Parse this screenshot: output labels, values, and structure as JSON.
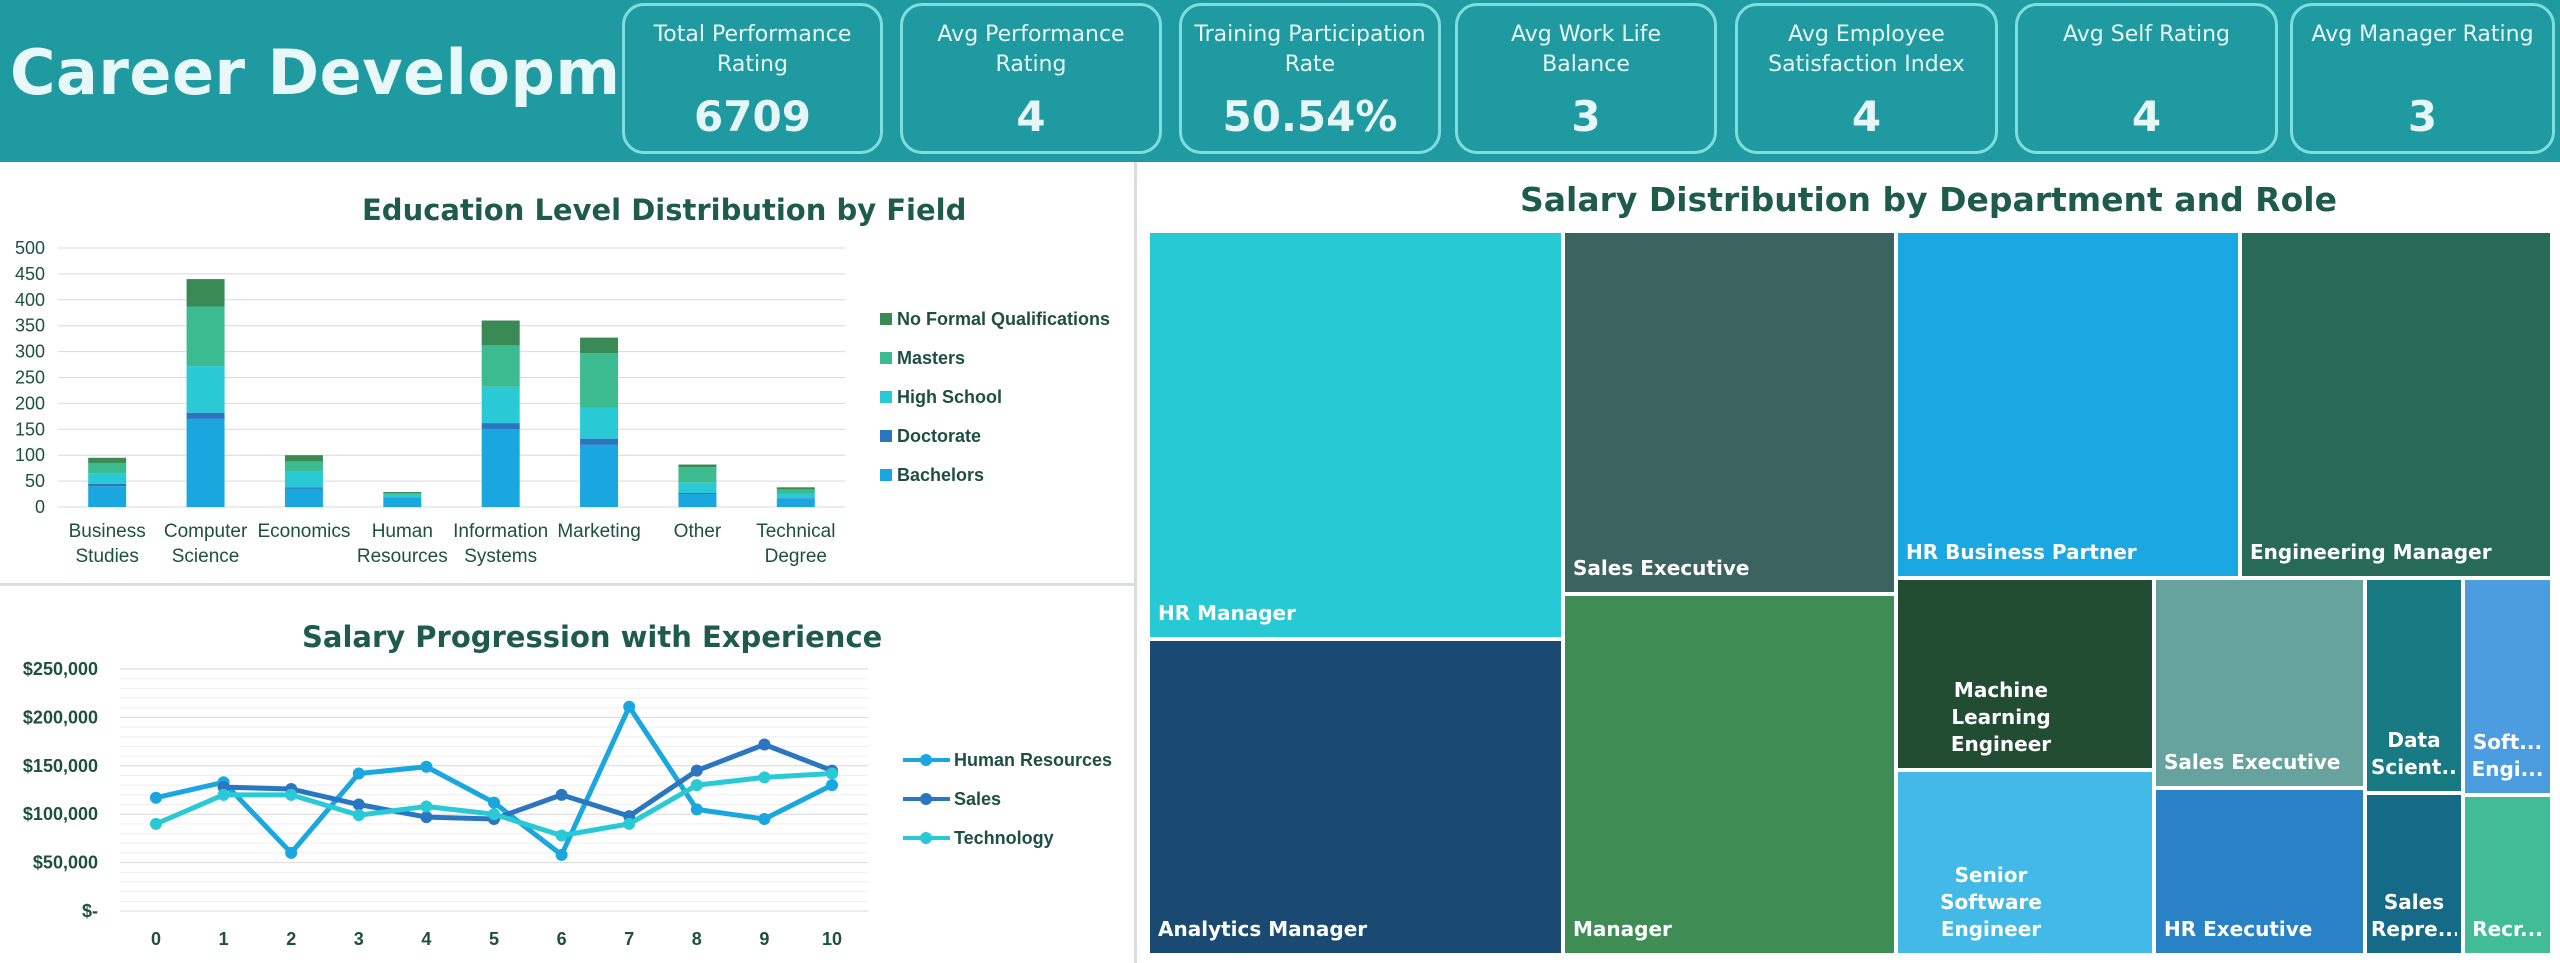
{
  "header": {
    "title": "Career Development",
    "kpis": [
      {
        "label": "Total Performance Rating",
        "value": "6709"
      },
      {
        "label": "Avg Performance Rating",
        "value": "4"
      },
      {
        "label": "Training Participation Rate",
        "value": "50.54%"
      },
      {
        "label": "Avg Work Life Balance",
        "value": "3"
      },
      {
        "label": "Avg Employee Satisfaction Index",
        "value": "4"
      },
      {
        "label": "Avg Self Rating",
        "value": "4"
      },
      {
        "label": "Avg Manager Rating",
        "value": "3"
      }
    ]
  },
  "colors": {
    "header_bg": "#1f9aa0",
    "kpi_border": "#7fdde0",
    "title_text": "#1e5b4a"
  },
  "chart_data": [
    {
      "type": "bar",
      "stacked": true,
      "title": "Education Level Distribution by Field",
      "categories": [
        "Business Studies",
        "Computer Science",
        "Economics",
        "Human Resources",
        "Information Systems",
        "Marketing",
        "Other",
        "Technical Degree"
      ],
      "category_lines": [
        [
          "Business",
          "Studies"
        ],
        [
          "Computer",
          "Science"
        ],
        [
          "Economics"
        ],
        [
          "Human",
          "Resources"
        ],
        [
          "Information",
          "Systems"
        ],
        [
          "Marketing"
        ],
        [
          "Other"
        ],
        [
          "Technical",
          "Degree"
        ]
      ],
      "ylim": [
        0,
        500
      ],
      "yticks": [
        0,
        50,
        100,
        150,
        200,
        250,
        300,
        350,
        400,
        450,
        500
      ],
      "legend_position": "right",
      "series": [
        {
          "name": "Bachelors",
          "color": "#1aa7e0",
          "values": [
            40,
            170,
            35,
            18,
            150,
            120,
            25,
            17
          ]
        },
        {
          "name": "Doctorate",
          "color": "#2b76c0",
          "values": [
            5,
            12,
            3,
            1,
            12,
            12,
            2,
            1
          ]
        },
        {
          "name": "High School",
          "color": "#2ac9d6",
          "values": [
            20,
            90,
            30,
            5,
            70,
            60,
            20,
            8
          ]
        },
        {
          "name": "Masters",
          "color": "#3dbb90",
          "values": [
            20,
            115,
            20,
            3,
            80,
            105,
            30,
            8
          ]
        },
        {
          "name": "No Formal Qualifications",
          "color": "#3a8a55",
          "values": [
            10,
            53,
            12,
            2,
            48,
            30,
            5,
            4
          ]
        }
      ]
    },
    {
      "type": "line",
      "title": "Salary Progression with Experience",
      "x": [
        0,
        1,
        2,
        3,
        4,
        5,
        6,
        7,
        8,
        9,
        10
      ],
      "ylim": [
        0,
        250000
      ],
      "yticks": [
        "$-",
        "$50,000",
        "$100,000",
        "$150,000",
        "$200,000",
        "$250,000"
      ],
      "ytick_values": [
        0,
        50000,
        100000,
        150000,
        200000,
        250000
      ],
      "legend_position": "right",
      "series": [
        {
          "name": "Human Resources",
          "color": "#1aa7e0",
          "values": [
            117000,
            133000,
            60000,
            142000,
            149000,
            112000,
            58000,
            211000,
            105000,
            95000,
            130000
          ]
        },
        {
          "name": "Sales",
          "color": "#2b76c0",
          "values": [
            null,
            128000,
            126000,
            110000,
            97000,
            95000,
            120000,
            98000,
            145000,
            172000,
            145000
          ]
        },
        {
          "name": "Technology",
          "color": "#2ac9d6",
          "values": [
            90000,
            120000,
            120000,
            99000,
            108000,
            100000,
            78000,
            90000,
            130000,
            138000,
            142000
          ]
        }
      ]
    }
  ],
  "treemap": {
    "title": "Salary Distribution by Department and Role",
    "cells": [
      {
        "label": "HR Manager",
        "color": "#26c9d4"
      },
      {
        "label": "Analytics Manager",
        "color": "#1a4a72"
      },
      {
        "label": "Sales Executive",
        "color": "#3b6360"
      },
      {
        "label": "Manager",
        "color": "#3f8d55"
      },
      {
        "label": "HR Business Partner",
        "color": "#1ba8e2"
      },
      {
        "label": "Engineering Manager",
        "color": "#276b57"
      },
      {
        "label": "Machine Learning Engineer",
        "color": "#234d33"
      },
      {
        "label": "Senior Software Engineer",
        "color": "#42b9e6"
      },
      {
        "label": "Sales Executive",
        "color": "#66a39f"
      },
      {
        "label": "HR Executive",
        "color": "#2a82c6"
      },
      {
        "label": "Data Scient...",
        "color": "#187b83"
      },
      {
        "label": "Sales Repre...",
        "color": "#156a87"
      },
      {
        "label": "Soft... Engi...",
        "color": "#4b9de0"
      },
      {
        "label": "Recr...",
        "color": "#41bc95"
      }
    ]
  }
}
